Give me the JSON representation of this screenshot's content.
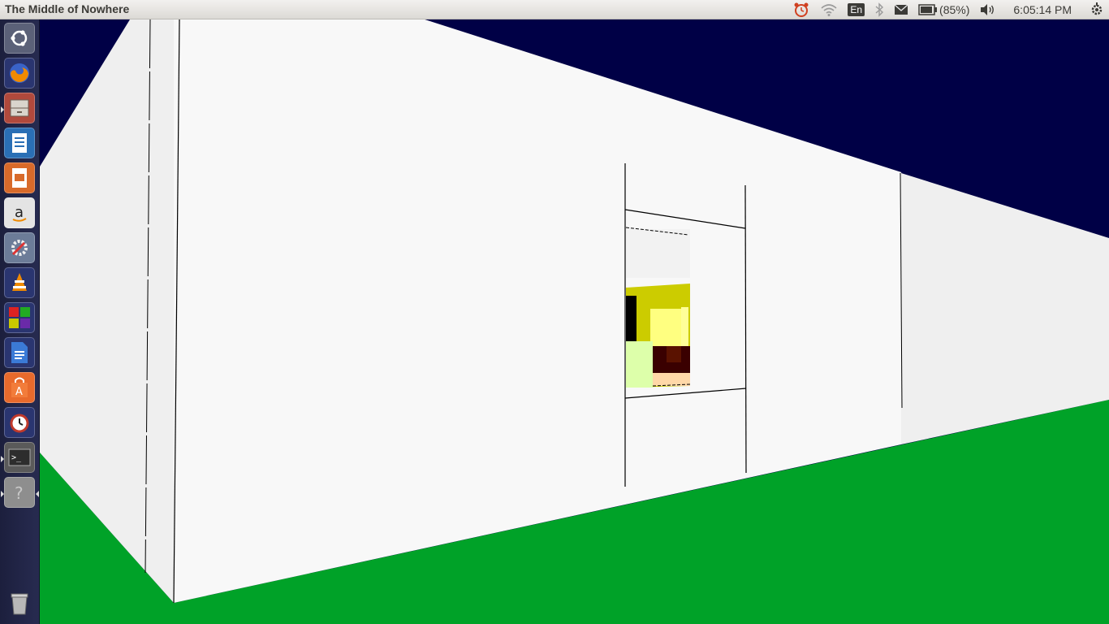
{
  "panel": {
    "window_title": "The Middle of Nowhere",
    "keyboard_layout": "En",
    "battery": "(85%)",
    "clock": "6:05:14 PM",
    "icons": [
      "alarm-clock-icon",
      "wifi-icon",
      "keyboard-layout-indicator",
      "bluetooth-icon",
      "mail-icon",
      "battery-icon",
      "volume-icon",
      "session-gear-icon"
    ]
  },
  "launcher": {
    "items": [
      {
        "name": "dash-home",
        "color": "#5b6178"
      },
      {
        "name": "firefox",
        "color": "#e66000"
      },
      {
        "name": "files",
        "color": "#b0493c"
      },
      {
        "name": "libreoffice-writer",
        "color": "#2a6fb5"
      },
      {
        "name": "libreoffice-impress",
        "color": "#d86a2a"
      },
      {
        "name": "amazon",
        "color": "#d8d8d8"
      },
      {
        "name": "system-settings",
        "color": "#7a8aa0"
      },
      {
        "name": "vlc",
        "color": "#f08a00"
      },
      {
        "name": "app-grid",
        "color": "#3c6fc0"
      },
      {
        "name": "documents",
        "color": "#3b7ad6"
      },
      {
        "name": "ubuntu-software",
        "color": "#e86a2c"
      },
      {
        "name": "alarm-clock",
        "color": "#c0392b"
      },
      {
        "name": "terminal",
        "color": "#2d2d2d"
      },
      {
        "name": "unknown-app",
        "color": "#8e8e8e"
      },
      {
        "name": "trash",
        "color": "#4a4f6a"
      }
    ]
  },
  "scene": {
    "sky_color": "#000046",
    "ground_color": "#00a228",
    "wall_color": "#f8f8f8",
    "side_wall_color": "#efefef",
    "accent_yellow": "#cccc00"
  }
}
